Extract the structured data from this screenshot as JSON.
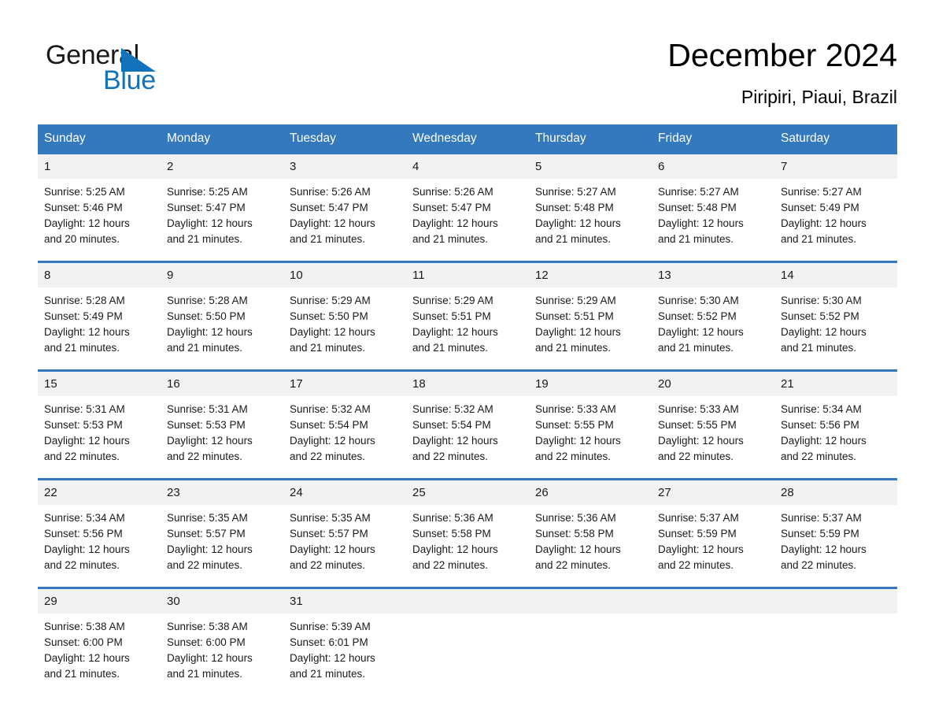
{
  "brand": {
    "name_part1": "General",
    "name_part2": "Blue",
    "triangle_icon": "triangle-icon",
    "accent_color": "#1272bb"
  },
  "header": {
    "title": "December 2024",
    "location": "Piripiri, Piaui, Brazil"
  },
  "theme": {
    "header_bar_color": "#3479bd",
    "date_band_color": "#f2f2f2",
    "text_color": "#1a1a1a",
    "page_background": "#ffffff"
  },
  "calendar": {
    "day_headers": [
      "Sunday",
      "Monday",
      "Tuesday",
      "Wednesday",
      "Thursday",
      "Friday",
      "Saturday"
    ],
    "weeks": [
      [
        {
          "date": "1",
          "sunrise": "Sunrise: 5:25 AM",
          "sunset": "Sunset: 5:46 PM",
          "daylight_line1": "Daylight: 12 hours",
          "daylight_line2": "and 20 minutes."
        },
        {
          "date": "2",
          "sunrise": "Sunrise: 5:25 AM",
          "sunset": "Sunset: 5:47 PM",
          "daylight_line1": "Daylight: 12 hours",
          "daylight_line2": "and 21 minutes."
        },
        {
          "date": "3",
          "sunrise": "Sunrise: 5:26 AM",
          "sunset": "Sunset: 5:47 PM",
          "daylight_line1": "Daylight: 12 hours",
          "daylight_line2": "and 21 minutes."
        },
        {
          "date": "4",
          "sunrise": "Sunrise: 5:26 AM",
          "sunset": "Sunset: 5:47 PM",
          "daylight_line1": "Daylight: 12 hours",
          "daylight_line2": "and 21 minutes."
        },
        {
          "date": "5",
          "sunrise": "Sunrise: 5:27 AM",
          "sunset": "Sunset: 5:48 PM",
          "daylight_line1": "Daylight: 12 hours",
          "daylight_line2": "and 21 minutes."
        },
        {
          "date": "6",
          "sunrise": "Sunrise: 5:27 AM",
          "sunset": "Sunset: 5:48 PM",
          "daylight_line1": "Daylight: 12 hours",
          "daylight_line2": "and 21 minutes."
        },
        {
          "date": "7",
          "sunrise": "Sunrise: 5:27 AM",
          "sunset": "Sunset: 5:49 PM",
          "daylight_line1": "Daylight: 12 hours",
          "daylight_line2": "and 21 minutes."
        }
      ],
      [
        {
          "date": "8",
          "sunrise": "Sunrise: 5:28 AM",
          "sunset": "Sunset: 5:49 PM",
          "daylight_line1": "Daylight: 12 hours",
          "daylight_line2": "and 21 minutes."
        },
        {
          "date": "9",
          "sunrise": "Sunrise: 5:28 AM",
          "sunset": "Sunset: 5:50 PM",
          "daylight_line1": "Daylight: 12 hours",
          "daylight_line2": "and 21 minutes."
        },
        {
          "date": "10",
          "sunrise": "Sunrise: 5:29 AM",
          "sunset": "Sunset: 5:50 PM",
          "daylight_line1": "Daylight: 12 hours",
          "daylight_line2": "and 21 minutes."
        },
        {
          "date": "11",
          "sunrise": "Sunrise: 5:29 AM",
          "sunset": "Sunset: 5:51 PM",
          "daylight_line1": "Daylight: 12 hours",
          "daylight_line2": "and 21 minutes."
        },
        {
          "date": "12",
          "sunrise": "Sunrise: 5:29 AM",
          "sunset": "Sunset: 5:51 PM",
          "daylight_line1": "Daylight: 12 hours",
          "daylight_line2": "and 21 minutes."
        },
        {
          "date": "13",
          "sunrise": "Sunrise: 5:30 AM",
          "sunset": "Sunset: 5:52 PM",
          "daylight_line1": "Daylight: 12 hours",
          "daylight_line2": "and 21 minutes."
        },
        {
          "date": "14",
          "sunrise": "Sunrise: 5:30 AM",
          "sunset": "Sunset: 5:52 PM",
          "daylight_line1": "Daylight: 12 hours",
          "daylight_line2": "and 21 minutes."
        }
      ],
      [
        {
          "date": "15",
          "sunrise": "Sunrise: 5:31 AM",
          "sunset": "Sunset: 5:53 PM",
          "daylight_line1": "Daylight: 12 hours",
          "daylight_line2": "and 22 minutes."
        },
        {
          "date": "16",
          "sunrise": "Sunrise: 5:31 AM",
          "sunset": "Sunset: 5:53 PM",
          "daylight_line1": "Daylight: 12 hours",
          "daylight_line2": "and 22 minutes."
        },
        {
          "date": "17",
          "sunrise": "Sunrise: 5:32 AM",
          "sunset": "Sunset: 5:54 PM",
          "daylight_line1": "Daylight: 12 hours",
          "daylight_line2": "and 22 minutes."
        },
        {
          "date": "18",
          "sunrise": "Sunrise: 5:32 AM",
          "sunset": "Sunset: 5:54 PM",
          "daylight_line1": "Daylight: 12 hours",
          "daylight_line2": "and 22 minutes."
        },
        {
          "date": "19",
          "sunrise": "Sunrise: 5:33 AM",
          "sunset": "Sunset: 5:55 PM",
          "daylight_line1": "Daylight: 12 hours",
          "daylight_line2": "and 22 minutes."
        },
        {
          "date": "20",
          "sunrise": "Sunrise: 5:33 AM",
          "sunset": "Sunset: 5:55 PM",
          "daylight_line1": "Daylight: 12 hours",
          "daylight_line2": "and 22 minutes."
        },
        {
          "date": "21",
          "sunrise": "Sunrise: 5:34 AM",
          "sunset": "Sunset: 5:56 PM",
          "daylight_line1": "Daylight: 12 hours",
          "daylight_line2": "and 22 minutes."
        }
      ],
      [
        {
          "date": "22",
          "sunrise": "Sunrise: 5:34 AM",
          "sunset": "Sunset: 5:56 PM",
          "daylight_line1": "Daylight: 12 hours",
          "daylight_line2": "and 22 minutes."
        },
        {
          "date": "23",
          "sunrise": "Sunrise: 5:35 AM",
          "sunset": "Sunset: 5:57 PM",
          "daylight_line1": "Daylight: 12 hours",
          "daylight_line2": "and 22 minutes."
        },
        {
          "date": "24",
          "sunrise": "Sunrise: 5:35 AM",
          "sunset": "Sunset: 5:57 PM",
          "daylight_line1": "Daylight: 12 hours",
          "daylight_line2": "and 22 minutes."
        },
        {
          "date": "25",
          "sunrise": "Sunrise: 5:36 AM",
          "sunset": "Sunset: 5:58 PM",
          "daylight_line1": "Daylight: 12 hours",
          "daylight_line2": "and 22 minutes."
        },
        {
          "date": "26",
          "sunrise": "Sunrise: 5:36 AM",
          "sunset": "Sunset: 5:58 PM",
          "daylight_line1": "Daylight: 12 hours",
          "daylight_line2": "and 22 minutes."
        },
        {
          "date": "27",
          "sunrise": "Sunrise: 5:37 AM",
          "sunset": "Sunset: 5:59 PM",
          "daylight_line1": "Daylight: 12 hours",
          "daylight_line2": "and 22 minutes."
        },
        {
          "date": "28",
          "sunrise": "Sunrise: 5:37 AM",
          "sunset": "Sunset: 5:59 PM",
          "daylight_line1": "Daylight: 12 hours",
          "daylight_line2": "and 22 minutes."
        }
      ],
      [
        {
          "date": "29",
          "sunrise": "Sunrise: 5:38 AM",
          "sunset": "Sunset: 6:00 PM",
          "daylight_line1": "Daylight: 12 hours",
          "daylight_line2": "and 21 minutes."
        },
        {
          "date": "30",
          "sunrise": "Sunrise: 5:38 AM",
          "sunset": "Sunset: 6:00 PM",
          "daylight_line1": "Daylight: 12 hours",
          "daylight_line2": "and 21 minutes."
        },
        {
          "date": "31",
          "sunrise": "Sunrise: 5:39 AM",
          "sunset": "Sunset: 6:01 PM",
          "daylight_line1": "Daylight: 12 hours",
          "daylight_line2": "and 21 minutes."
        },
        {
          "date": "",
          "sunrise": "",
          "sunset": "",
          "daylight_line1": "",
          "daylight_line2": ""
        },
        {
          "date": "",
          "sunrise": "",
          "sunset": "",
          "daylight_line1": "",
          "daylight_line2": ""
        },
        {
          "date": "",
          "sunrise": "",
          "sunset": "",
          "daylight_line1": "",
          "daylight_line2": ""
        },
        {
          "date": "",
          "sunrise": "",
          "sunset": "",
          "daylight_line1": "",
          "daylight_line2": ""
        }
      ]
    ]
  }
}
